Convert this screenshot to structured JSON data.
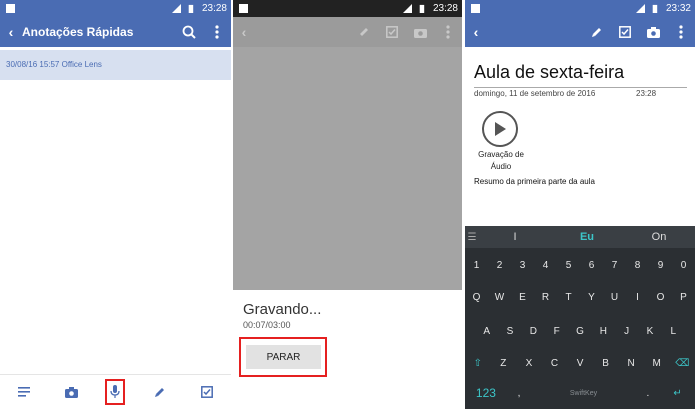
{
  "colors": {
    "accent": "#4a6cb3",
    "record_highlight": "#e52020",
    "teal": "#3cc6c9"
  },
  "status": {
    "p1_time": "23:28",
    "p2_time": "23:28",
    "p3_time": "23:32"
  },
  "panel1": {
    "title": "Anotações Rápidas",
    "note": "30/08/16 15:57 Office Lens",
    "bottom_icons": [
      "list-icon",
      "camera-icon",
      "microphone-icon",
      "pencil-icon",
      "checkbox-icon"
    ]
  },
  "panel2": {
    "recording_label": "Gravando...",
    "recording_time": "00:07/03:00",
    "stop_label": "PARAR"
  },
  "panel3": {
    "doc_title": "Aula de sexta-feira",
    "doc_date": "domingo, 11 de setembro de 2016",
    "doc_time": "23:28",
    "audio_label_1": "Gravação de",
    "audio_label_2": "Áudio",
    "summary": "Resumo da primeira parte da aula",
    "suggestions": [
      "I",
      "Eu",
      "On"
    ],
    "keyboard": {
      "numbers": [
        "1",
        "2",
        "3",
        "4",
        "5",
        "6",
        "7",
        "8",
        "9",
        "0"
      ],
      "row1": [
        "Q",
        "W",
        "E",
        "R",
        "T",
        "Y",
        "U",
        "I",
        "O",
        "P"
      ],
      "row2": [
        "A",
        "S",
        "D",
        "F",
        "G",
        "H",
        "J",
        "K",
        "L"
      ],
      "row3": [
        "Z",
        "X",
        "C",
        "V",
        "B",
        "N",
        "M"
      ],
      "key_123": "123",
      "brand": "SwiftKey"
    }
  }
}
